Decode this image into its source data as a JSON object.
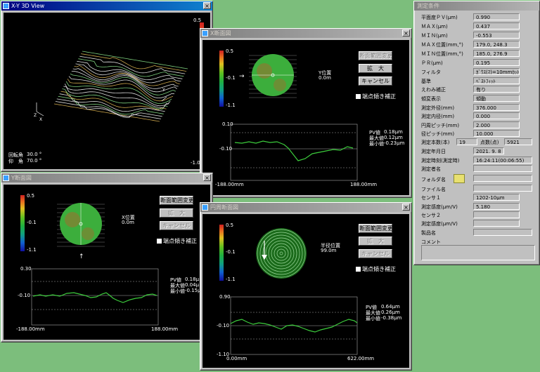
{
  "win_3d": {
    "title": "X-Y 3D View",
    "rot_label": "回転角",
    "rot_value": "30.0 °",
    "elev_label": "仰　角",
    "elev_value": "70.0 °",
    "scale_top": "0.5",
    "scale_bottom": "-1.0",
    "axis_x": "X",
    "axis_y": "Y",
    "axis_z": "Z"
  },
  "win_x": {
    "title": "X断面図",
    "scale_top": "0.5",
    "scale_mid": "-0.1",
    "scale_bottom": "-1.1",
    "pos_label": "Y位置",
    "pos_value": "0.0m",
    "btn_change": "断面範囲変更",
    "btn_zoom": "拡　大",
    "btn_cancel": "キャンセル",
    "check_label": "端点傾き補正",
    "y_top": "0.10",
    "y_mid": "-0.10",
    "x_left": "-188.00mm",
    "x_right": "188.00mm",
    "pv_label": "PV値",
    "pv": "0.18μm",
    "max_label": "最大値",
    "max": "0.12μm",
    "min_label": "最小値",
    "min": "-0.23μm"
  },
  "win_y": {
    "title": "Y断面図",
    "scale_top": "0.5",
    "scale_mid": "-0.1",
    "scale_bottom": "-1.1",
    "pos_label": "X位置",
    "pos_value": "0.0m",
    "btn_change": "断面範囲変更",
    "btn_zoom": "拡　大",
    "btn_cancel": "キャンセル",
    "check_label": "端点傾き補正",
    "y_top": "0.30",
    "y_mid": "-0.10",
    "x_left": "-188.00mm",
    "x_right": "188.00mm",
    "pv_label": "PV値",
    "pv": "0.18μ",
    "max_label": "最大値",
    "max": "0.04μ",
    "min_label": "最小値",
    "min": "-0.15μ"
  },
  "win_c": {
    "title": "円周断面図",
    "scale_top": "0.5",
    "scale_mid": "-0.1",
    "scale_bottom": "-1.1",
    "pos_label": "半径位置",
    "pos_value": "99.0m",
    "btn_change": "断面範囲変更",
    "btn_zoom": "拡　大",
    "btn_cancel": "キャンセル",
    "check_label": "端点傾き補正",
    "y_top": "0.90",
    "y_mid": "-0.10",
    "y_bottom": "-1.10",
    "x_left": "0.00mm",
    "x_right": "622.00mm",
    "pv_label": "PV値",
    "pv": "0.64μm",
    "max_label": "最大値",
    "max": "0.26μm",
    "min_label": "最小値",
    "min": "-0.38μm"
  },
  "cond": {
    "title": "測定条件",
    "rows": [
      {
        "label": "平面度ＰＶ(μm)",
        "value": "0.990"
      },
      {
        "label": "ＭＡＸ(μm)",
        "value": "0.437"
      },
      {
        "label": "ＭＩＮ(μm)",
        "value": "-0.553"
      },
      {
        "label": "ＭＡＸ位置(mm,°)",
        "value": "179.0, 248.3"
      },
      {
        "label": "ＭＩＮ位置(mm,°)",
        "value": "185.0, 276.9"
      },
      {
        "label": "ＰＲ(μm)",
        "value": "0.195"
      },
      {
        "label": "フィルタ",
        "value": "ｶﾞｳｽ(ﾏ)=10mmｶｯﾄｵﾌ"
      },
      {
        "label": "基準",
        "value": "ﾍﾞｽﾄﾌｨｯﾄ"
      },
      {
        "label": "えわみ補正",
        "value": "有り"
      },
      {
        "label": "傾変表示",
        "value": "傾動"
      },
      {
        "label": "測定外径(mm)",
        "value": "376.000"
      },
      {
        "label": "測定内径(mm)",
        "value": "0.000"
      },
      {
        "label": "円周ピッチ(mm)",
        "value": "2.000"
      },
      {
        "label": "径ピッチ(mm)",
        "value": "10.000"
      }
    ],
    "lines_label": "測定本数(本)",
    "lines_value": "19",
    "points_label": "点数(点)",
    "points_value": "5921",
    "date_label": "測定年月日",
    "date_value": "2021. 9. 8",
    "time_label": "測定時刻(測定時)",
    "time_value": "16:24:11(00:06:55)",
    "operator_label": "測定者名",
    "folder_label": "フォルダ名",
    "file_label": "ファイル名",
    "sensor1_label": "センサ１",
    "sensor1_value": "1202-10μm",
    "sens1_label": "測定感度(μm/V)",
    "sens1_value": "5.180",
    "sensor2_label": "センサ２",
    "sens2_label": "測定感度(μm/V)",
    "product_label": "製品名",
    "comment_label": "コメント"
  }
}
